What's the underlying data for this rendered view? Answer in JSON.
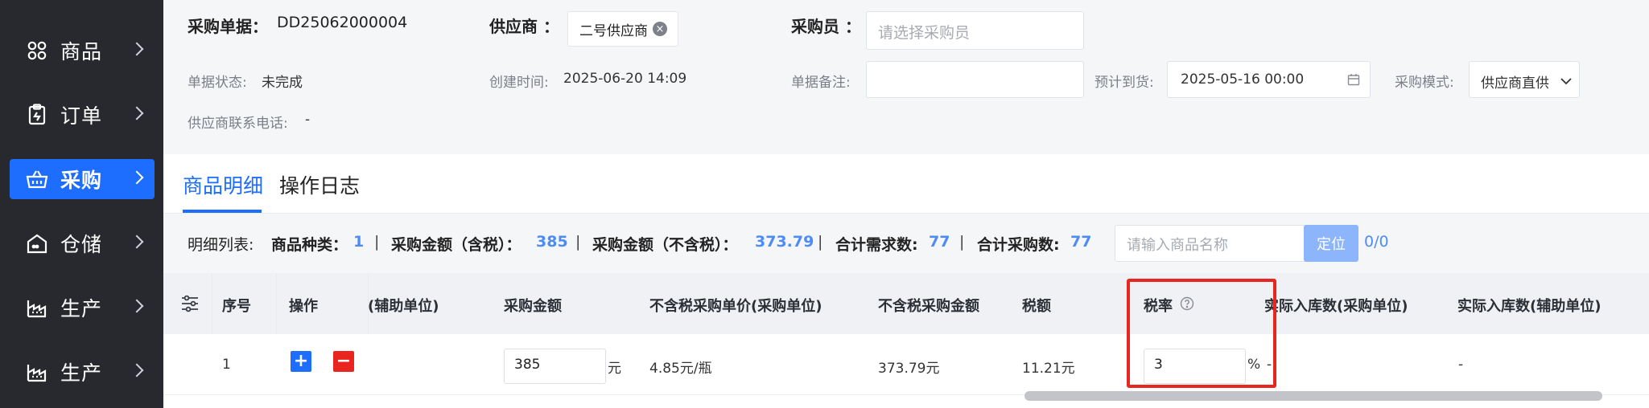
{
  "sidebar": {
    "items": [
      {
        "label": "商品",
        "icon": "grid-icon"
      },
      {
        "label": "订单",
        "icon": "clipboard-icon"
      },
      {
        "label": "采购",
        "icon": "basket-icon",
        "active": true
      },
      {
        "label": "仓储",
        "icon": "warehouse-icon"
      },
      {
        "label": "生产",
        "icon": "factory-icon"
      },
      {
        "label": "生产",
        "icon": "factory-icon"
      }
    ]
  },
  "header": {
    "order_no_label": "采购单据：",
    "order_no": "DD25062000004",
    "supplier_label": "供应商 ：",
    "supplier_tag": "二号供应商",
    "buyer_label": "采购员 ：",
    "buyer_placeholder": "请选择采购员",
    "status_label": "单据状态:",
    "status_value": "未完成",
    "created_label": "创建时间:",
    "created_value": "2025-06-20 14:09",
    "remark_label": "单据备注:",
    "remark_value": "",
    "eta_label": "预计到货:",
    "eta_value": "2025-05-16 00:00",
    "mode_label": "采购模式:",
    "mode_value": "供应商直供",
    "phone_label": "供应商联系电话:",
    "phone_value": "-"
  },
  "tabs": [
    {
      "label": "商品明细",
      "active": true
    },
    {
      "label": "操作日志",
      "active": false
    }
  ],
  "summary": {
    "list_label": "明细列表:",
    "kinds_label": "商品种类：",
    "kinds_value": "1",
    "sep": "|",
    "amount_tax_label": "采购金额（含税）：",
    "amount_tax_value": "385",
    "amount_notax_label": "采购金额（不含税）：",
    "amount_notax_value": "373.79",
    "demand_label": "合计需求数:",
    "demand_value": "77",
    "purchase_label": "合计采购数:",
    "purchase_value": "77",
    "search_placeholder": "请输入商品名称",
    "locate_label": "定位",
    "match_count": "0/0"
  },
  "table": {
    "headers": {
      "index": "序号",
      "action": "操作",
      "aux_unit": "(辅助单位)",
      "amount": "采购金额",
      "unit_price_notax": "不含税采购单价(采购单位)",
      "amount_notax": "不含税采购金额",
      "tax": "税额",
      "tax_rate": "税率",
      "in_qty_purchase": "实际入库数(采购单位)",
      "in_qty_aux": "实际入库数(辅助单位)"
    },
    "rows": [
      {
        "index": "1",
        "amount": "385",
        "amount_unit": "元",
        "unit_price_notax": "4.85元/瓶",
        "amount_notax": "373.79元",
        "tax": "11.21元",
        "tax_rate": "3",
        "tax_rate_unit": "%",
        "in_qty_purchase": "-",
        "in_qty_aux": "-"
      }
    ]
  },
  "colors": {
    "accent": "#1d6dff",
    "sidebar_bg": "#27292e",
    "highlight": "#e8251f",
    "number": "#4d8cf5"
  }
}
